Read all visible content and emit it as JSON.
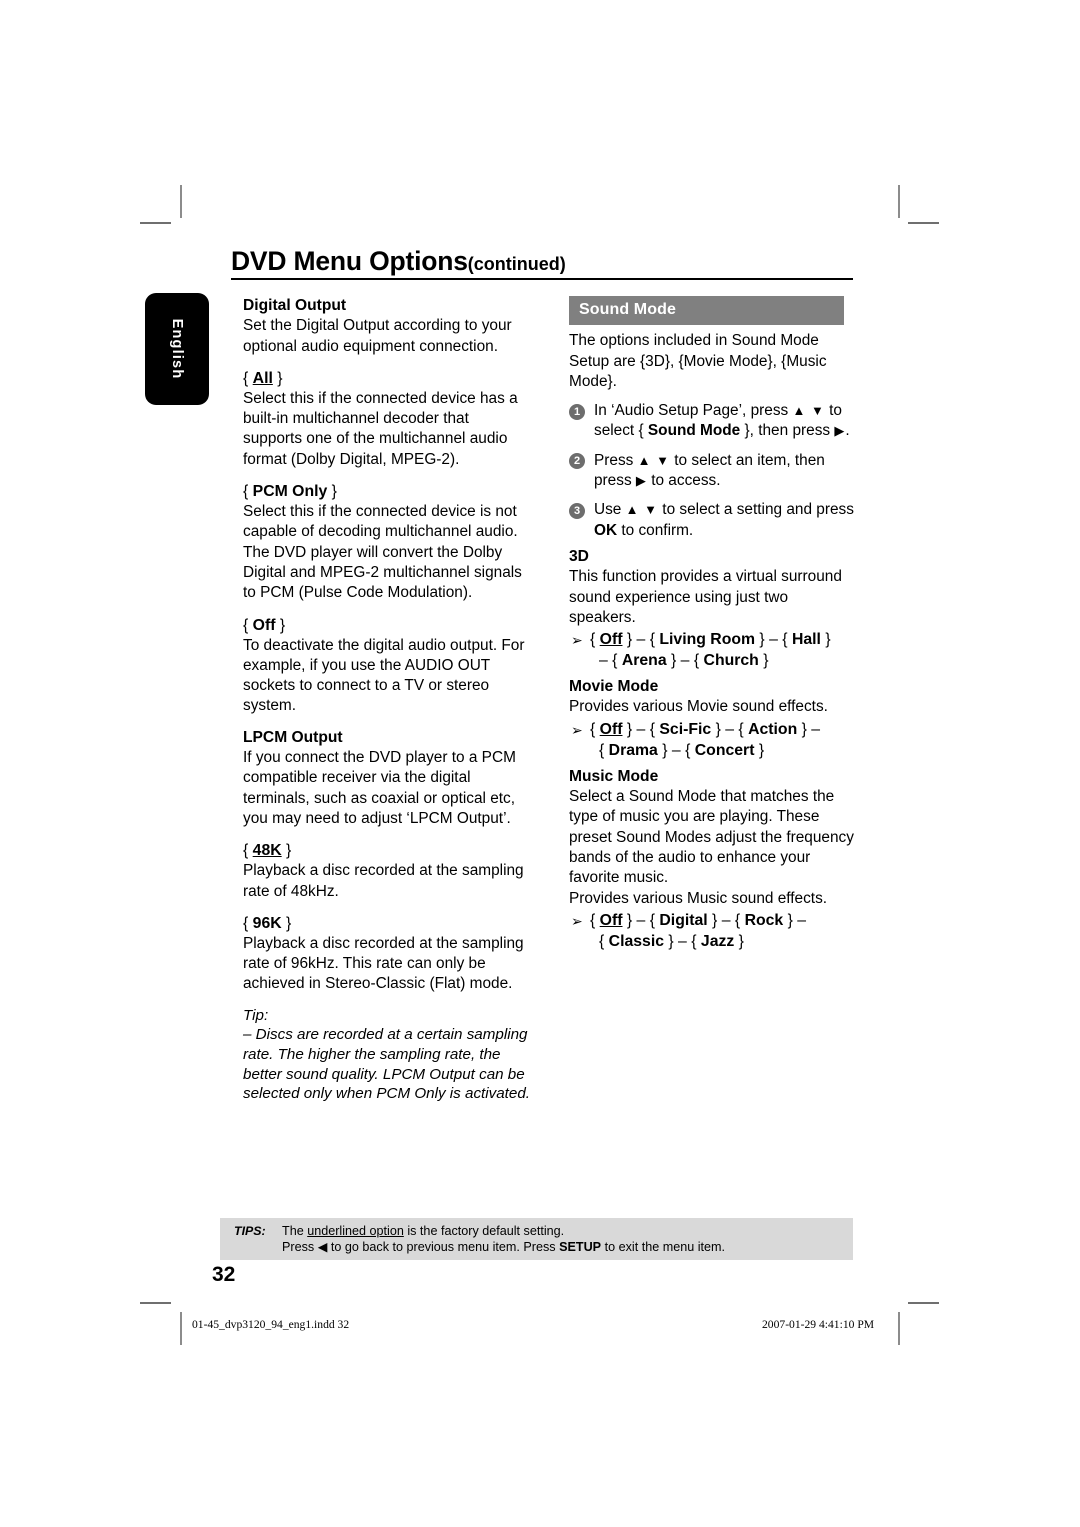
{
  "page": {
    "title_main": "DVD Menu Options",
    "title_continued": "(continued)",
    "language_tab": "English",
    "page_number": "32"
  },
  "left_column": {
    "digital_output": {
      "heading": "Digital Output",
      "intro": "Set the Digital Output according to your optional audio equipment connection.",
      "options": [
        {
          "label": "All",
          "underlined": true,
          "body": "Select this if the connected device has a built-in multichannel decoder that supports one of the multichannel audio format (Dolby Digital, MPEG-2)."
        },
        {
          "label": "PCM Only",
          "underlined": false,
          "body": "Select this if the connected device is not capable of decoding multichannel audio. The DVD player will convert the Dolby Digital and MPEG-2 multichannel signals to PCM (Pulse Code Modulation)."
        },
        {
          "label": "Off",
          "underlined": false,
          "body": "To deactivate the digital audio output. For example, if you use the AUDIO OUT sockets to connect to a TV or stereo system."
        }
      ]
    },
    "lpcm_output": {
      "heading": "LPCM Output",
      "intro": "If you connect the DVD player to a PCM compatible receiver via the digital terminals, such as coaxial or optical etc, you may need to adjust ‘LPCM Output’.",
      "options": [
        {
          "label": "48K",
          "underlined": true,
          "body": "Playback a disc recorded at the sampling rate of 48kHz."
        },
        {
          "label": "96K",
          "underlined": false,
          "body": "Playback a disc recorded at the sampling rate of 96kHz. This rate can only be achieved in Stereo-Classic (Flat) mode."
        }
      ]
    },
    "tip": {
      "label": "Tip:",
      "text": "– Discs are recorded at a certain sampling rate. The higher the sampling rate, the better sound quality. LPCM Output can be selected only when PCM Only is activated."
    }
  },
  "right_column": {
    "section_title": "Sound Mode",
    "intro": "The options included in Sound Mode Setup are {3D}, {Movie Mode}, {Music Mode}.",
    "steps": [
      {
        "num": "1",
        "part1": "In ‘Audio Setup Page’, press ",
        "keys1": "▲ ▼",
        "part2": " to select { ",
        "bold1": "Sound Mode",
        "part3": " }, then press ",
        "keys2": "▶",
        "part4": "."
      },
      {
        "num": "2",
        "part1": "Press ",
        "keys1": "▲ ▼",
        "part2": " to select an item, then press ",
        "keys2": "▶",
        "part3": " to access."
      },
      {
        "num": "3",
        "part1": "Use ",
        "keys1": "▲ ▼",
        "part2": " to select a setting and press ",
        "bold1": "OK",
        "part3": " to confirm."
      }
    ],
    "modes": [
      {
        "heading": "3D",
        "body": "This function provides a virtual surround sound experience using just two speakers.",
        "option_line_1": [
          {
            "text": "Off",
            "underlined": true
          },
          {
            "text": "Living Room",
            "underlined": false
          },
          {
            "text": "Hall",
            "underlined": false
          }
        ],
        "option_line_2": [
          {
            "text": "Arena",
            "underlined": false
          },
          {
            "text": "Church",
            "underlined": false
          }
        ]
      },
      {
        "heading": "Movie Mode",
        "body": "Provides various Movie sound effects.",
        "option_line_1": [
          {
            "text": "Off",
            "underlined": true
          },
          {
            "text": "Sci-Fic",
            "underlined": false
          },
          {
            "text": "Action",
            "underlined": false
          }
        ],
        "option_line_2": [
          {
            "text": "Drama",
            "underlined": false
          },
          {
            "text": "Concert",
            "underlined": false
          }
        ]
      },
      {
        "heading": "Music Mode",
        "body": "Select a Sound Mode that matches the type of music you are playing. These preset Sound Modes adjust the frequency bands of the audio to enhance your favorite music.",
        "body2": "Provides various Music sound effects.",
        "option_line_1": [
          {
            "text": "Off",
            "underlined": true
          },
          {
            "text": "Digital",
            "underlined": false
          },
          {
            "text": "Rock",
            "underlined": false
          }
        ],
        "option_line_2": [
          {
            "text": "Classic",
            "underlined": false
          },
          {
            "text": "Jazz",
            "underlined": false
          }
        ]
      }
    ]
  },
  "tips_footer": {
    "label": "TIPS:",
    "line1_pre": "The ",
    "line1_underlined": "underlined option",
    "line1_post": " is the factory default setting.",
    "line2_pre": "Press ",
    "line2_key": "◀",
    "line2_mid": " to go back to previous menu item. Press ",
    "line2_bold": "SETUP",
    "line2_post": " to exit the menu item."
  },
  "print_footer": {
    "file": "01-45_dvp3120_94_eng1.indd   32",
    "timestamp": "2007-01-29   4:41:10 PM"
  },
  "colors": {
    "section_bar": "#808080",
    "tips_box": "#d9d9d9",
    "step_bullet": "#6d6d6d",
    "lang_tab": "#000000"
  }
}
